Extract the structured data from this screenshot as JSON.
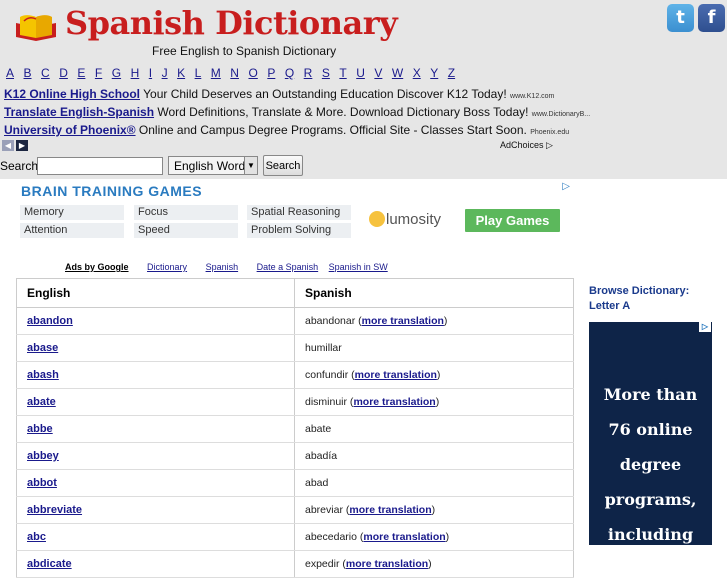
{
  "header": {
    "logo_text": "Spanish Dictionary",
    "tagline": "Free English to Spanish Dictionary",
    "twitter_glyph": "t",
    "facebook_glyph": "f"
  },
  "alphabet": [
    "A",
    "B",
    "C",
    "D",
    "E",
    "F",
    "G",
    "H",
    "I",
    "J",
    "K",
    "L",
    "M",
    "N",
    "O",
    "P",
    "Q",
    "R",
    "S",
    "T",
    "U",
    "V",
    "W",
    "X",
    "Y",
    "Z"
  ],
  "text_ads": [
    {
      "title": "K12 Online High School",
      "body": "Your Child Deserves an Outstanding Education Discover K12 Today!",
      "url": "www.K12.com"
    },
    {
      "title": "Translate English-Spanish",
      "body": "Word Definitions, Translate & More. Download Dictionary Boss Today!",
      "url": "www.DictionaryB..."
    },
    {
      "title": "University of Phoenix®",
      "body": "Online and Campus Degree Programs. Official Site - Classes Start Soon.",
      "url": "Phoenix.edu"
    }
  ],
  "adchoices": "AdChoices",
  "search": {
    "label": "Search",
    "value": "",
    "language": "English Word",
    "button": "Search"
  },
  "brain_ad": {
    "title": "BRAIN TRAINING GAMES",
    "tiles": [
      "Memory",
      "Focus",
      "Spatial Reasoning",
      "Attention",
      "Speed",
      "Problem Solving"
    ],
    "brand": "lumosity",
    "cta": "Play Games"
  },
  "links": [
    "Ads by Google",
    "Dictionary",
    "Spanish",
    "Date a Spanish",
    "Spanish in SW"
  ],
  "table": {
    "headers": [
      "English",
      "Spanish"
    ],
    "more_label": "more translation",
    "rows": [
      {
        "en": "abandon",
        "es": "abandonar",
        "more": true
      },
      {
        "en": "abase",
        "es": "humillar",
        "more": false
      },
      {
        "en": "abash",
        "es": "confundir",
        "more": true
      },
      {
        "en": "abate",
        "es": "disminuir",
        "more": true
      },
      {
        "en": "abbe",
        "es": "abate",
        "more": false
      },
      {
        "en": "abbey",
        "es": "abadía",
        "more": false
      },
      {
        "en": "abbot",
        "es": "abad",
        "more": false
      },
      {
        "en": "abbreviate",
        "es": "abreviar",
        "more": true
      },
      {
        "en": "abc",
        "es": "abecedario",
        "more": true
      },
      {
        "en": "abdicate",
        "es": "expedir",
        "more": true
      }
    ]
  },
  "browse": {
    "line1": "Browse Dictionary:",
    "line2": "Letter A"
  },
  "side_ad": [
    "More than",
    "76 online",
    "degree",
    "programs,",
    "including"
  ],
  "colors": {
    "brand_red": "#c81e1e",
    "link": "#1a1a8c",
    "play_green": "#5cb85c",
    "side_ad_bg": "#0e2448"
  }
}
